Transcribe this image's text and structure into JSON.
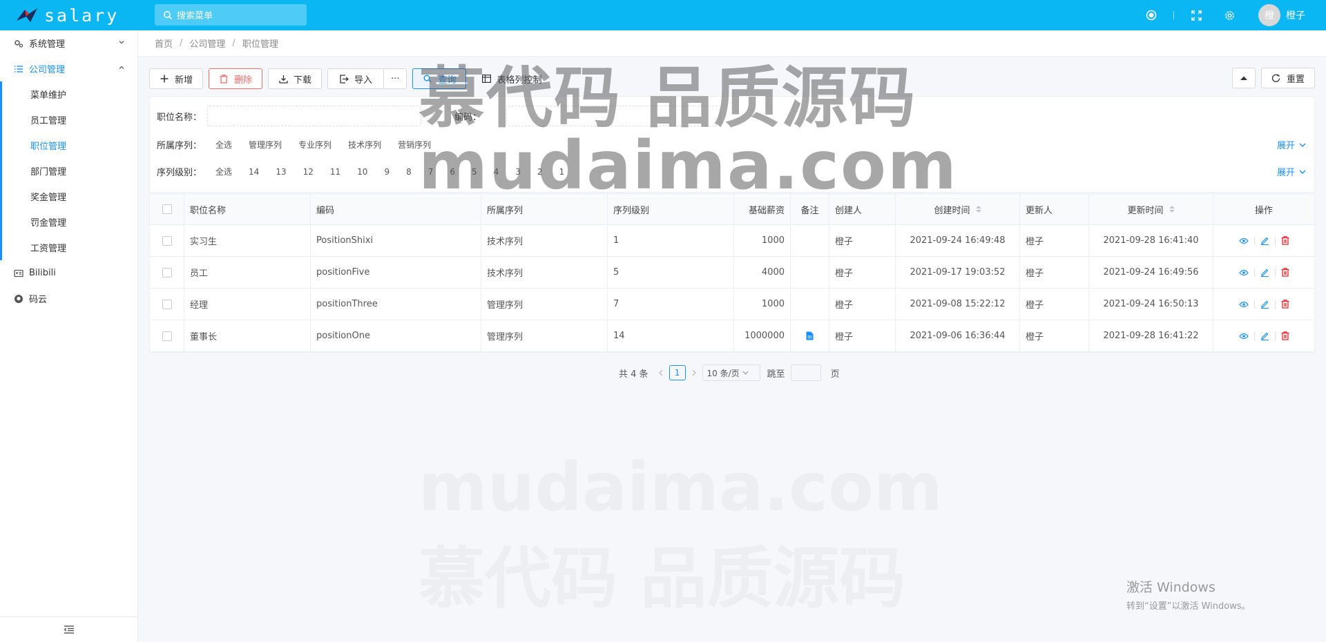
{
  "app": {
    "logo_text": "salary"
  },
  "search": {
    "placeholder": "搜索菜单"
  },
  "user": {
    "avatar_char": "橙",
    "name": "橙子"
  },
  "sidebar": {
    "items": [
      {
        "label": "系统管理"
      },
      {
        "label": "公司管理"
      }
    ],
    "sub": [
      {
        "label": "菜单维护"
      },
      {
        "label": "员工管理"
      },
      {
        "label": "职位管理"
      },
      {
        "label": "部门管理"
      },
      {
        "label": "奖金管理"
      },
      {
        "label": "罚金管理"
      },
      {
        "label": "工资管理"
      }
    ],
    "extra": [
      {
        "label": "Bilibili"
      },
      {
        "label": "码云"
      }
    ]
  },
  "breadcrumb": [
    "首页",
    "公司管理",
    "职位管理"
  ],
  "toolbar": {
    "add": "新增",
    "delete": "删除",
    "download": "下载",
    "import": "导入",
    "more": "···",
    "query": "查询",
    "columns": "表格列控制",
    "reset": "重置"
  },
  "filter": {
    "name_label": "职位名称：",
    "code_label": "编码：",
    "seq_label": "所属序列：",
    "seq_options": [
      "全选",
      "管理序列",
      "专业序列",
      "技术序列",
      "营销序列"
    ],
    "level_label": "序列级别：",
    "level_options": [
      "全选",
      "14",
      "13",
      "12",
      "11",
      "10",
      "9",
      "8",
      "7",
      "6",
      "5",
      "4",
      "3",
      "2",
      "1"
    ],
    "expand": "展开"
  },
  "table": {
    "headers": [
      "职位名称",
      "编码",
      "所属序列",
      "序列级别",
      "基础薪资",
      "备注",
      "创建人",
      "创建时间",
      "更新人",
      "更新时间",
      "操作"
    ],
    "rows": [
      {
        "name": "实习生",
        "code": "PositionShixi",
        "seq": "技术序列",
        "level": "1",
        "salary": "1000",
        "note": "",
        "creator": "橙子",
        "created": "2021-09-24 16:49:48",
        "updater": "橙子",
        "updated": "2021-09-28 16:41:40"
      },
      {
        "name": "员工",
        "code": "positionFive",
        "seq": "技术序列",
        "level": "5",
        "salary": "4000",
        "note": "",
        "creator": "橙子",
        "created": "2021-09-17 19:03:52",
        "updater": "橙子",
        "updated": "2021-09-24 16:49:56"
      },
      {
        "name": "经理",
        "code": "positionThree",
        "seq": "管理序列",
        "level": "7",
        "salary": "1000",
        "note": "",
        "creator": "橙子",
        "created": "2021-09-08 15:22:12",
        "updater": "橙子",
        "updated": "2021-09-24 16:50:13"
      },
      {
        "name": "董事长",
        "code": "positionOne",
        "seq": "管理序列",
        "level": "14",
        "salary": "1000000",
        "note": "doc",
        "creator": "橙子",
        "created": "2021-09-06 16:36:44",
        "updater": "橙子",
        "updated": "2021-09-28 16:41:22"
      }
    ]
  },
  "pager": {
    "total": "共 4 条",
    "current": "1",
    "size": "10 条/页",
    "jump_label": "跳至",
    "page_unit": "页"
  },
  "watermark": {
    "line1": "慕代码 品质源码",
    "line2": "mudaima.com"
  },
  "windows": {
    "line1": "激活 Windows",
    "line2": "转到“设置”以激活 Windows。"
  },
  "colors": {
    "header": "#0ab7f3",
    "accent": "#1890ff",
    "danger": "#f56c6c"
  }
}
